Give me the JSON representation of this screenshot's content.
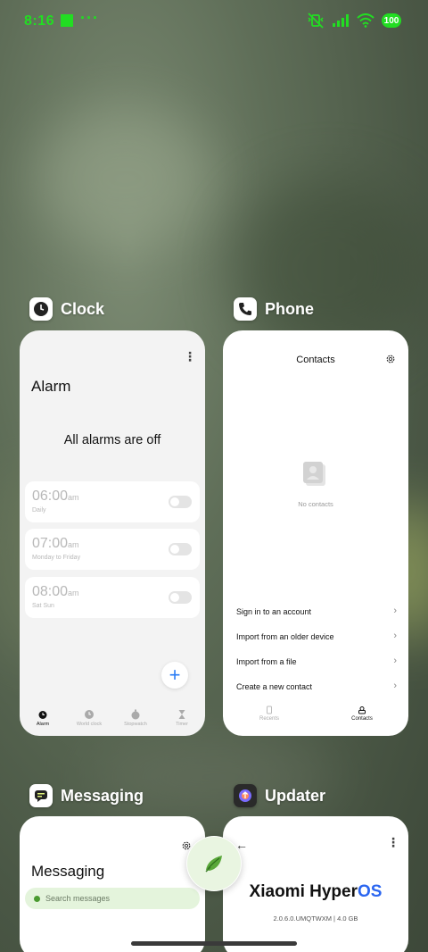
{
  "status_bar": {
    "time": "8:16",
    "dots": "···",
    "battery": "100"
  },
  "clock": {
    "app_name": "Clock",
    "title": "Alarm",
    "empty_message": "All alarms are off",
    "alarms": [
      {
        "time": "06:00",
        "suffix": "am",
        "repeat": "Daily"
      },
      {
        "time": "07:00",
        "suffix": "am",
        "repeat": "Monday to Friday"
      },
      {
        "time": "08:00",
        "suffix": "am",
        "repeat": "Sat Sun"
      }
    ],
    "add_label": "+",
    "tabs": [
      "Alarm",
      "World clock",
      "Stopwatch",
      "Timer"
    ]
  },
  "phone": {
    "app_name": "Phone",
    "title": "Contacts",
    "empty_message": "No contacts",
    "menu": [
      "Sign in to an account",
      "Import from an older device",
      "Import from a file",
      "Create a new contact"
    ],
    "tabs": [
      "Recents",
      "Contacts"
    ]
  },
  "messaging": {
    "app_name": "Messaging",
    "title": "Messaging",
    "search_placeholder": "Search messages"
  },
  "updater": {
    "app_name": "Updater",
    "brand_main": "Xiaomi Hyper",
    "brand_accent": "OS",
    "version": "2.0.6.0.UMQTWXM | 4.0 GB"
  },
  "colors": {
    "status_green": "#22dd22",
    "accent_blue": "#2a7cf5",
    "hyperos_blue": "#2b66f0",
    "search_green": "#e4f4dc"
  }
}
